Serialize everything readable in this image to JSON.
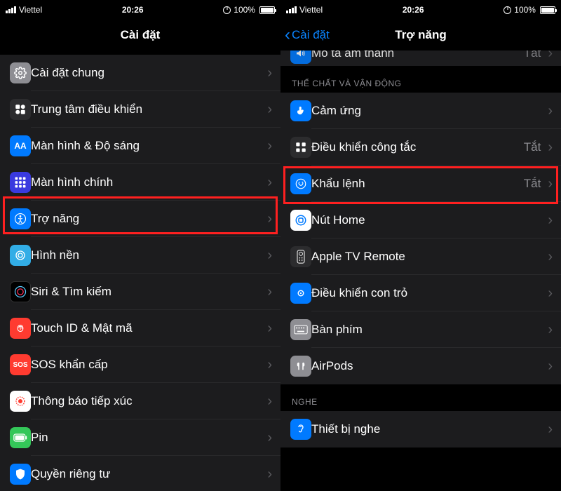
{
  "status": {
    "carrier": "Viettel",
    "time": "20:26",
    "battery_pct": "100%"
  },
  "left": {
    "nav_title": "Cài đặt",
    "rows": [
      {
        "label": "Cài đặt chung"
      },
      {
        "label": "Trung tâm điều khiển"
      },
      {
        "label": "Màn hình & Độ sáng"
      },
      {
        "label": "Màn hình chính"
      },
      {
        "label": "Trợ năng"
      },
      {
        "label": "Hình nền"
      },
      {
        "label": "Siri & Tìm kiếm"
      },
      {
        "label": "Touch ID & Mật mã"
      },
      {
        "label": "SOS khẩn cấp"
      },
      {
        "label": "Thông báo tiếp xúc"
      },
      {
        "label": "Pin"
      },
      {
        "label": "Quyền riêng tư"
      }
    ]
  },
  "right": {
    "nav_title": "Trợ năng",
    "nav_back": "Cài đặt",
    "partial_top": {
      "label": "Mô tả âm thanh",
      "value": "Tắt"
    },
    "section1": "THỂ CHẤT VÀ VẬN ĐỘNG",
    "rows1": [
      {
        "label": "Cảm ứng",
        "value": ""
      },
      {
        "label": "Điều khiển công tắc",
        "value": "Tắt"
      },
      {
        "label": "Khẩu lệnh",
        "value": "Tắt"
      },
      {
        "label": "Nút Home",
        "value": ""
      },
      {
        "label": "Apple TV Remote",
        "value": ""
      },
      {
        "label": "Điều khiển con trỏ",
        "value": ""
      },
      {
        "label": "Bàn phím",
        "value": ""
      },
      {
        "label": "AirPods",
        "value": ""
      }
    ],
    "section2": "NGHE",
    "rows2": [
      {
        "label": "Thiết bị nghe",
        "value": ""
      }
    ]
  }
}
